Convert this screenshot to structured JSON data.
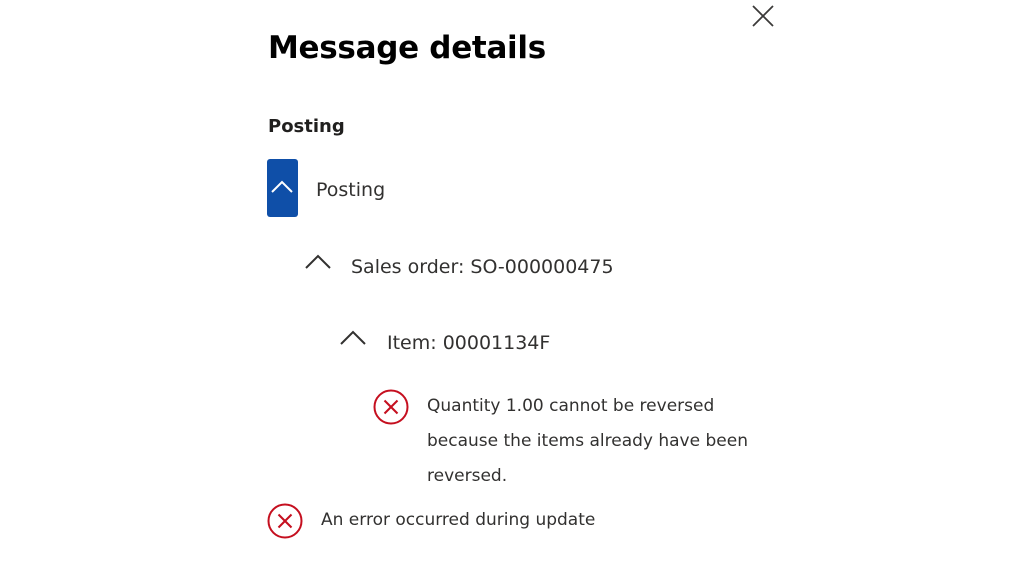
{
  "dialog": {
    "title": "Message details",
    "close_icon": "close-icon",
    "section_heading": "Posting"
  },
  "tree": {
    "root": {
      "label": "Posting",
      "expanded": true,
      "icon": "chevron-up-icon"
    },
    "sales_order": {
      "label": "Sales order: SO-000000475",
      "expanded": true,
      "icon": "chevron-up-icon"
    },
    "item": {
      "label": "Item: 00001134F",
      "expanded": true,
      "icon": "chevron-up-icon"
    },
    "item_error": {
      "icon": "error-circle-icon",
      "message_lines": [
        "Quantity 1.00 cannot be reversed",
        "because the items already have been",
        "reversed."
      ]
    }
  },
  "summary_error": {
    "icon": "error-circle-icon",
    "message": "An error occurred during update"
  },
  "colors": {
    "accent": "#0f4fa8",
    "error": "#c50f1f",
    "text": "#323130"
  }
}
